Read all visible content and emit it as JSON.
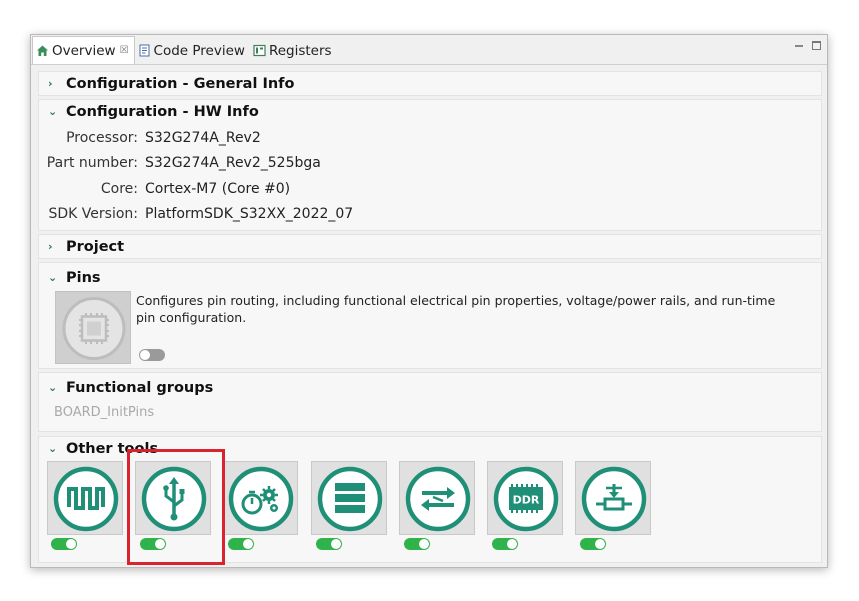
{
  "tabs": [
    {
      "label": "Overview",
      "close": "☒",
      "icon": "home-icon",
      "active": true
    },
    {
      "label": "Code Preview",
      "icon": "code-file-icon",
      "active": false
    },
    {
      "label": "Registers",
      "icon": "registers-icon",
      "active": false
    }
  ],
  "sections": {
    "general": {
      "title": "Configuration - General Info",
      "expanded": false
    },
    "hw": {
      "title": "Configuration - HW Info",
      "expanded": true,
      "rows": [
        {
          "key": "Processor:",
          "value": "S32G274A_Rev2"
        },
        {
          "key": "Part number:",
          "value": "S32G274A_Rev2_525bga"
        },
        {
          "key": "Core:",
          "value": "Cortex-M7 (Core #0)"
        },
        {
          "key": "SDK Version:",
          "value": "PlatformSDK_S32XX_2022_07"
        }
      ]
    },
    "project": {
      "title": "Project",
      "expanded": false
    },
    "pins": {
      "title": "Pins",
      "expanded": true,
      "description": "Configures pin routing, including functional  electrical pin properties, voltage/power rails, and run-time pin configuration.",
      "enabled": false
    },
    "functional": {
      "title": "Functional groups",
      "expanded": true,
      "item": "BOARD_InitPins"
    },
    "tools": {
      "title": "Other tools",
      "expanded": true,
      "items": [
        {
          "icon": "clock-waveform-icon",
          "enabled": true
        },
        {
          "icon": "usb-icon",
          "enabled": true,
          "highlighted": true
        },
        {
          "icon": "timer-gears-icon",
          "enabled": true
        },
        {
          "icon": "stack-layers-icon",
          "enabled": true
        },
        {
          "icon": "bidirectional-arrows-icon",
          "enabled": true
        },
        {
          "icon": "ddr-chip-icon",
          "enabled": true,
          "label": "DDR"
        },
        {
          "icon": "sensor-resistor-icon",
          "enabled": true
        }
      ]
    }
  },
  "colors": {
    "accent": "#1f8f77",
    "toggle_on": "#2fb34a",
    "highlight": "#d9232e"
  }
}
